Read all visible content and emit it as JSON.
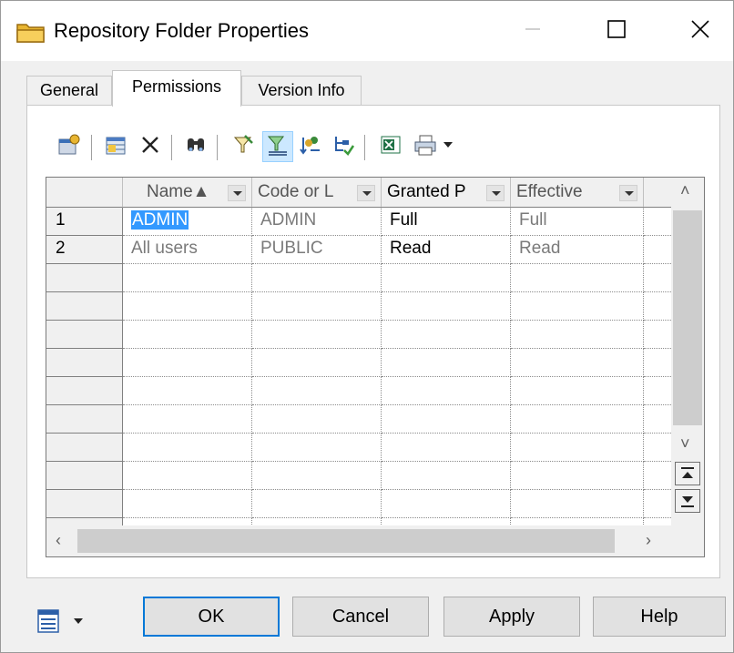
{
  "window": {
    "title": "Repository Folder Properties",
    "title_icon": "folder-icon",
    "controls": {
      "minimize": "minimize-icon",
      "maximize": "maximize-icon",
      "close": "close-icon"
    }
  },
  "tabs": [
    {
      "label": "General",
      "active": false
    },
    {
      "label": "Permissions",
      "active": true
    },
    {
      "label": "Version Info",
      "active": false
    }
  ],
  "toolbar": {
    "icons": [
      "properties-icon",
      "add-rows-icon",
      "delete-icon",
      "find-icon",
      "filter-icon",
      "filter-active-icon",
      "sort-users-icon",
      "export-tree-icon",
      "excel-export-icon",
      "print-icon",
      "print-dropdown-icon"
    ]
  },
  "grid": {
    "columns": [
      {
        "label": "Name▲"
      },
      {
        "label": "Code or L"
      },
      {
        "label": "Granted P"
      },
      {
        "label": "Effective"
      }
    ],
    "rows": [
      {
        "num": "1",
        "name": "ADMIN",
        "code": "ADMIN",
        "granted": "Full",
        "effective": "Full"
      },
      {
        "num": "2",
        "name": "All users",
        "code": "PUBLIC",
        "granted": "Read",
        "effective": "Read"
      }
    ],
    "empty_rows": 10
  },
  "buttons": {
    "ok": "OK",
    "cancel": "Cancel",
    "apply": "Apply",
    "help": "Help"
  },
  "colors": {
    "selection": "#3399ff",
    "accent": "#0078d7"
  }
}
